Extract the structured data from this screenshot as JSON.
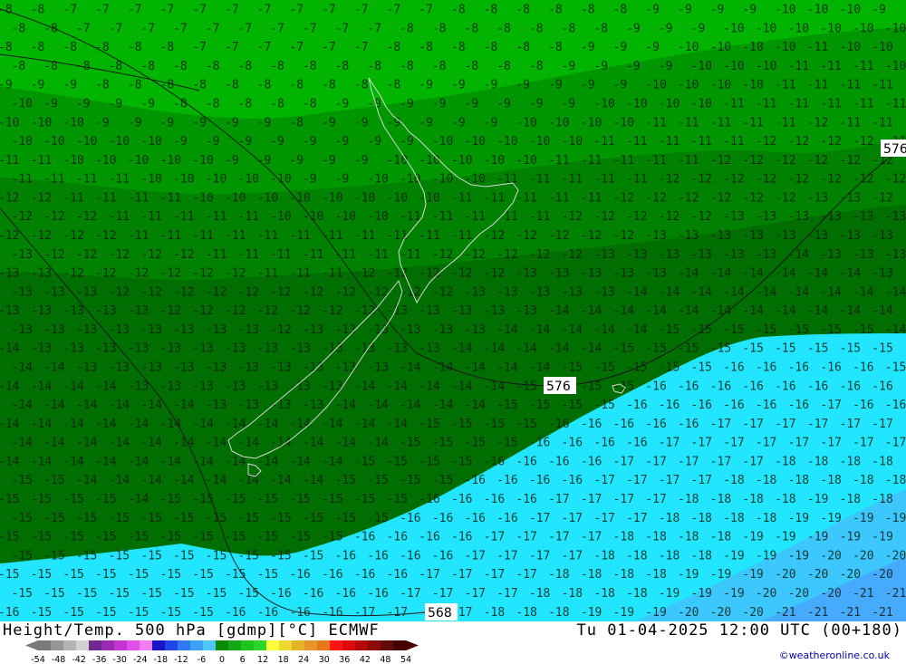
{
  "header": {
    "title_left": "Height/Temp. 500 hPa [gdmp][°C] ECMWF",
    "title_right": "Tu 01-04-2025 12:00 UTC (00+180)",
    "credit": "©weatheronline.co.uk"
  },
  "legend": {
    "ticks": [
      "-54",
      "-48",
      "-42",
      "-36",
      "-30",
      "-24",
      "-18",
      "-12",
      "-6",
      "0",
      "6",
      "12",
      "18",
      "24",
      "30",
      "36",
      "42",
      "48",
      "54"
    ],
    "colors": [
      "#7a7a7a",
      "#969696",
      "#b4b4b4",
      "#d2d2d2",
      "#6e2a8c",
      "#9a2bb4",
      "#c433d6",
      "#e44ee8",
      "#f27df2",
      "#1a14c8",
      "#2046e6",
      "#2e78f0",
      "#3ca2f4",
      "#4cc8f8",
      "#0a8c0a",
      "#14a814",
      "#1ec41e",
      "#2ad82a",
      "#ffff3c",
      "#f0d832",
      "#e6b428",
      "#e69628",
      "#e6781e",
      "#ff1414",
      "#dc0a0a",
      "#b40a0a",
      "#8c0a0a",
      "#640a0a",
      "#460000"
    ]
  },
  "map": {
    "contour_labels": [
      {
        "text": "576"
      },
      {
        "text": "576"
      },
      {
        "text": "568"
      }
    ],
    "zone_colors": {
      "band_minus8_to_minus10": "#00b400",
      "band_minus10_to_minus12": "#009600",
      "band_minus12_to_minus14": "#008200",
      "band_minus14_to_minus16": "#006e00",
      "band_minus16_to_minus18": "#22e6ff",
      "band_minus18_to_minus20": "#3cc8ff",
      "band_minus20_plus": "#46aaff"
    },
    "temperature_rows": [
      "-8 -8 -7 -7 -7 -7 -7 -7 -7 -7 -7 -7 -7 -7 -8 -8 -8 -8 -8 -8 -9 -9 -9 -9 -10 -10 -10 -9",
      "-8 -8 -7 -7 -7 -7 -7 -7 -7 -7 -7 -7 -8 -8 -8 -8 -8 -8 -8 -9 -9 -9 -10 -10 -10 -10 -10 -10",
      "-8 -8 -8 -8 -8 -8 -7 -7 -7 -7 -7 -7 -8 -8 -8 -8 -8 -8 -9 -9 -9 -10 -10 -10 -10 -11 -10 -10",
      "-8 -8 -8 -8 -8 -8 -8 -8 -8 -8 -8 -8 -8 -8 -8 -8 -8 -9 -9 -9 -9 -10 -10 -10 -11 -11 -11 -10",
      "-9 -9 -9 -8 -8 -8 -8 -8 -8 -8 -8 -8 -8 -9 -9 -9 -9 -9 -9 -9 -10 -10 -10 -10 -11 -11 -11 -11",
      "-10 -9 -9 -9 -9 -8 -8 -8 -8 -8 -9 -9 -9 -9 -9 -9 -9 -9 -10 -10 -10 -10 -11 -11 -11 -11 -11 -11",
      "-10 -10 -10 -9 -9 -9 -9 -9 -9 -8 -9 -9 -9 -9 -9 -9 -10 -10 -10 -10 -11 -11 -11 -11 -11 -12 -11 -11",
      "-10 -10 -10 -10 -10 -9 -9 -9 -9 -9 -9 -9 -9 -10 -10 -10 -10 -10 -11 -11 -11 -11 -11 -12 -12 -12 -12 -11",
      "-11 -11 -10 -10 -10 -10 -10 -9 -9 -9 -9 -9 -10 -10 -10 -10 -10 -11 -11 -11 -11 -11 -12 -12 -12 -12 -12 -12",
      "-11 -11 -11 -11 -10 -10 -10 -10 -10 -9 -9 -10 -10 -10 -10 -11 -11 -11 -11 -11 -12 -12 -12 -12 -12 -12 -12 -12",
      "-12 -12 -11 -11 -11 -11 -10 -10 -10 -10 -10 -10 -10 -10 -11 -11 -11 -11 -11 -12 -12 -12 -12 -12 -12 -13 -13 -12",
      "-12 -12 -12 -11 -11 -11 -11 -11 -10 -10 -10 -10 -11 -11 -11 -11 -11 -12 -12 -12 -12 -12 -13 -13 -13 -13 -13 -13",
      "-12 -12 -12 -12 -11 -11 -11 -11 -11 -11 -11 -11 -11 -11 -11 -12 -12 -12 -12 -12 -13 -13 -13 -13 -13 -13 -13 -13",
      "-13 -12 -12 -12 -12 -12 -11 -11 -11 -11 -11 -11 -11 -12 -12 -12 -12 -12 -13 -13 -13 -13 -13 -13 -14 -13 -13 -13",
      "-13 -13 -12 -12 -12 -12 -12 -12 -11 -11 -11 -12 -12 -12 -12 -12 -13 -13 -13 -13 -13 -14 -14 -14 -14 -14 -14 -13",
      "-13 -13 -13 -12 -12 -12 -12 -12 -12 -12 -12 -12 -12 -12 -13 -13 -13 -13 -13 -14 -14 -14 -14 -14 -14 -14 -14 -14",
      "-13 -13 -13 -13 -13 -12 -12 -12 -12 -12 -12 -12 -13 -13 -13 -13 -13 -14 -14 -14 -14 -14 -14 -14 -14 -14 -14 -14",
      "-13 -13 -13 -13 -13 -13 -13 -13 -12 -13 -13 -13 -13 -13 -13 -14 -14 -14 -14 -14 -15 -15 -15 -15 -15 -15 -15 -14",
      "-14 -13 -13 -13 -13 -13 -13 -13 -13 -13 -13 -13 -13 -13 -14 -14 -14 -14 -14 -15 -15 -15 -15 -15 -15 -15 -15 -15",
      "-14 -14 -13 -13 -13 -13 -13 -13 -13 -13 -13 -13 -14 -14 -14 -14 -14 -15 -15 -15 -15 -15 -16 -16 -16 -16 -16 -15",
      "-14 -14 -14 -14 -13 -13 -13 -13 -13 -13 -13 -14 -14 -14 -14 -14 -15 -15 -15 -15 -16 -16 -16 -16 -16 -16 -16 -16",
      "-14 -14 -14 -14 -14 -14 -13 -13 -13 -13 -14 -14 -14 -14 -14 -15 -15 -15 -15 -16 -16 -16 -16 -16 -16 -17 -16 -16",
      "-14 -14 -14 -14 -14 -14 -14 -14 -14 -14 -14 -14 -14 -15 -15 -15 -15 -16 -16 -16 -16 -16 -17 -17 -17 -17 -17 -17",
      "-14 -14 -14 -14 -14 -14 -14 -14 -14 -14 -14 -14 -15 -15 -15 -15 -16 -16 -16 -16 -17 -17 -17 -17 -17 -17 -17 -17",
      "-14 -14 -14 -14 -14 -14 -14 -14 -14 -14 -14 -15 -15 -15 -15 -16 -16 -16 -16 -17 -17 -17 -17 -17 -18 -18 -18 -18",
      "-15 -15 -14 -14 -14 -14 -14 -14 -14 -14 -15 -15 -15 -15 -16 -16 -16 -16 -17 -17 -17 -17 -18 -18 -18 -18 -18 -18",
      "-15 -15 -15 -15 -14 -15 -15 -15 -15 -15 -15 -15 -15 -16 -16 -16 -16 -17 -17 -17 -17 -18 -18 -18 -18 -19 -18 -18",
      "-15 -15 -15 -15 -15 -15 -15 -15 -15 -15 -15 -15 -16 -16 -16 -16 -17 -17 -17 -17 -18 -18 -18 -18 -19 -19 -19 -19",
      "-15 -15 -15 -15 -15 -15 -15 -15 -15 -15 -15 -16 -16 -16 -16 -17 -17 -17 -17 -18 -18 -18 -18 -19 -19 -19 -19 -19",
      "-15 -15 -15 -15 -15 -15 -15 -15 -15 -15 -16 -16 -16 -16 -17 -17 -17 -17 -18 -18 -18 -18 -19 -19 -19 -20 -20 -20",
      "-15 -15 -15 -15 -15 -15 -15 -15 -15 -16 -16 -16 -16 -17 -17 -17 -17 -18 -18 -18 -18 -19 -19 -19 -20 -20 -20 -20",
      "-15 -15 -15 -15 -15 -15 -15 -15 -16 -16 -16 -16 -17 -17 -17 -17 -18 -18 -18 -18 -19 -19 -19 -20 -20 -20 -21 -21",
      "-16 -15 -15 -15 -15 -15 -15 -16 -16 -16 -16 -17 -17 -17 -17 -18 -18 -18 -19 -19 -19 -20 -20 -20 -21 -21 -21 -21"
    ]
  }
}
